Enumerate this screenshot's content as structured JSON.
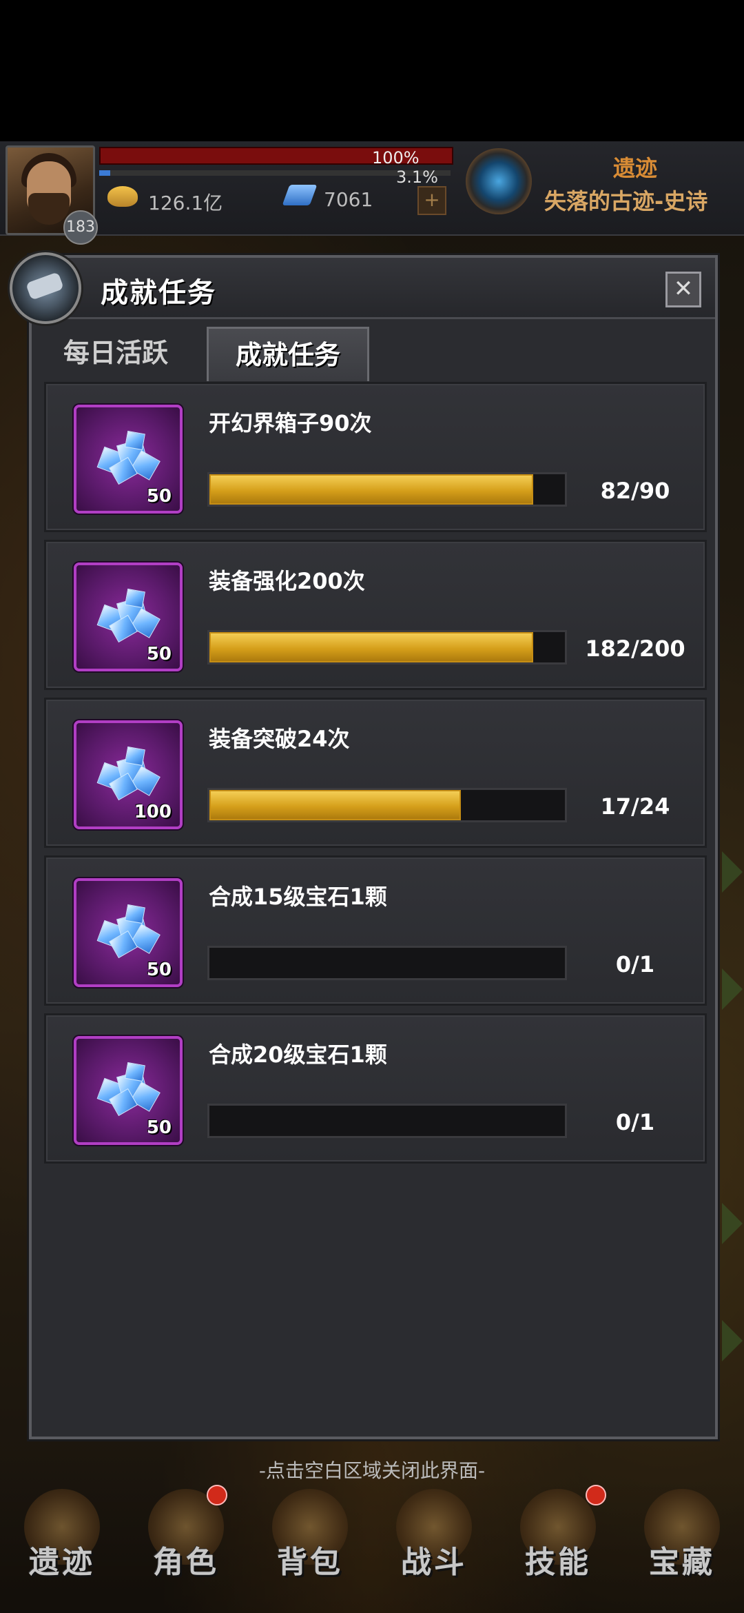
{
  "hud": {
    "level": "183",
    "hp_percent": "100%",
    "xp_percent": "3.1%",
    "gold": "126.1亿",
    "gems": "7061",
    "plus_label": "+",
    "location_title": "遗迹",
    "location_name": "失落的古迹-史诗"
  },
  "modal": {
    "title": "成就任务",
    "close_label": "✕",
    "tabs": [
      {
        "label": "每日活跃",
        "active": false
      },
      {
        "label": "成就任务",
        "active": true
      }
    ],
    "tasks": [
      {
        "name": "开幻界箱子90次",
        "reward_count": "50",
        "progress_text": "82/90",
        "progress": 0.911
      },
      {
        "name": "装备强化200次",
        "reward_count": "50",
        "progress_text": "182/200",
        "progress": 0.91
      },
      {
        "name": "装备突破24次",
        "reward_count": "100",
        "progress_text": "17/24",
        "progress": 0.708
      },
      {
        "name": "合成15级宝石1颗",
        "reward_count": "50",
        "progress_text": "0/1",
        "progress": 0
      },
      {
        "name": "合成20级宝石1颗",
        "reward_count": "50",
        "progress_text": "0/1",
        "progress": 0
      }
    ]
  },
  "close_hint": "-点击空白区域关闭此界面-",
  "bottom_nav": [
    {
      "label": "遗迹",
      "icon": "relic-icon",
      "badge": false
    },
    {
      "label": "角色",
      "icon": "character-icon",
      "badge": true
    },
    {
      "label": "背包",
      "icon": "backpack-icon",
      "badge": false
    },
    {
      "label": "战斗",
      "icon": "battle-icon",
      "badge": false
    },
    {
      "label": "技能",
      "icon": "skill-book-icon",
      "badge": true
    },
    {
      "label": "宝藏",
      "icon": "treasure-icon",
      "badge": false
    }
  ],
  "colors": {
    "progress_fill": "#d59f1a",
    "reward_frame": "#b13ec4",
    "location_title": "#d98c35"
  }
}
